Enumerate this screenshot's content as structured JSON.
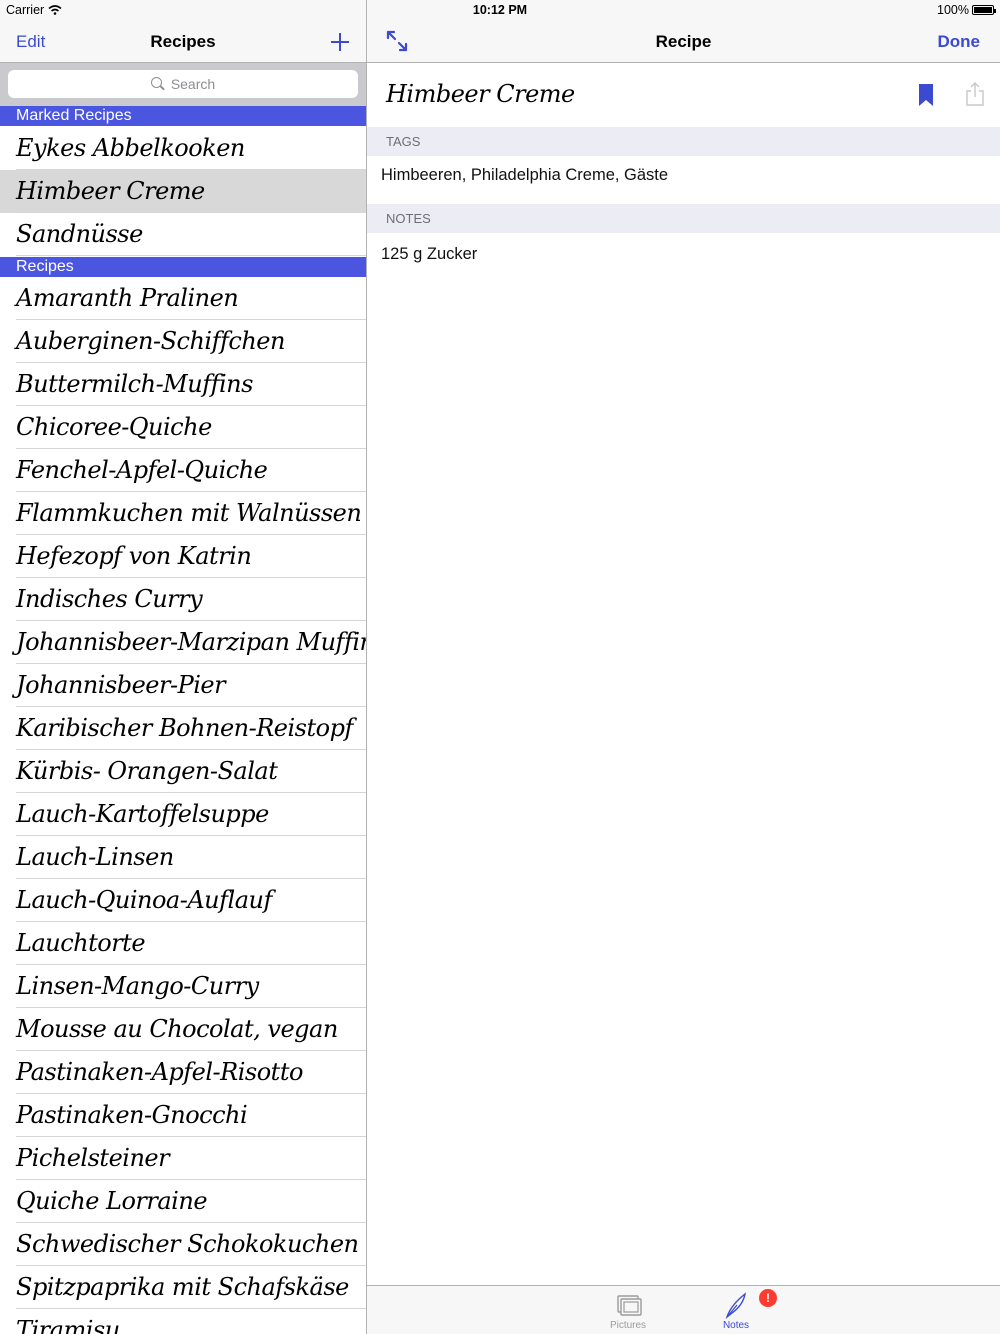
{
  "status_bar": {
    "carrier": "Carrier",
    "time": "10:12 PM",
    "battery": "100%"
  },
  "master": {
    "nav": {
      "edit_label": "Edit",
      "title": "Recipes",
      "add_icon": "plus-icon"
    },
    "search": {
      "placeholder": "Search"
    },
    "sections": [
      {
        "title": "Marked Recipes",
        "items": [
          "Eykes Abbelkooken",
          "Himbeer Creme",
          "Sandnüsse"
        ]
      },
      {
        "title": "Recipes",
        "items": [
          "Amaranth Pralinen",
          "Auberginen-Schiffchen",
          "Buttermilch-Muffins",
          "Chicoree-Quiche",
          "Fenchel-Apfel-Quiche",
          "Flammkuchen mit Walnüssen",
          "Hefezopf von Katrin",
          "Indisches Curry",
          "Johannisbeer-Marzipan Muffins",
          "Johannisbeer-Pier",
          "Karibischer Bohnen-Reistopf",
          "Kürbis- Orangen-Salat",
          "Lauch-Kartoffelsuppe",
          "Lauch-Linsen",
          "Lauch-Quinoa-Auflauf",
          "Lauchtorte",
          "Linsen-Mango-Curry",
          "Mousse au Chocolat, vegan",
          "Pastinaken-Apfel-Risotto",
          "Pastinaken-Gnocchi",
          "Pichelsteiner",
          "Quiche Lorraine",
          "Schwedischer Schokokuchen",
          "Spitzpaprika mit Schafskäse",
          "Tiramisu"
        ]
      }
    ],
    "selected_item": "Himbeer Creme"
  },
  "detail": {
    "nav": {
      "title": "Recipe",
      "done_label": "Done",
      "expand_icon": "expand-icon"
    },
    "recipe_title": "Himbeer Creme",
    "tags_header": "TAGS",
    "tags_value": "Himbeeren, Philadelphia Creme, Gäste",
    "notes_header": "NOTES",
    "notes_value": "125 g Zucker",
    "tabs": [
      {
        "label": "Pictures",
        "icon": "pictures-icon"
      },
      {
        "label": "Notes",
        "icon": "quill-icon",
        "badge": "!"
      }
    ]
  },
  "colors": {
    "accent": "#3b4ad0",
    "section_header": "#4a55e0",
    "selected_row": "#d8d8d8",
    "badge": "#ff3b30"
  }
}
